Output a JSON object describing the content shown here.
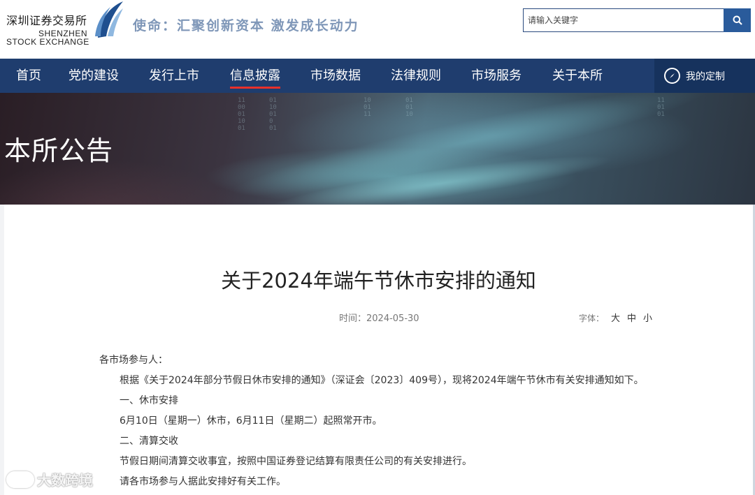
{
  "header": {
    "logo_cn": "深圳证券交易所",
    "logo_en_line1": "SHENZHEN",
    "logo_en_line2": "STOCK EXCHANGE",
    "slogan": "使命：汇聚创新资本 激发成长动力",
    "search_placeholder": "请输入关键字"
  },
  "nav": {
    "items": [
      {
        "label": "首页"
      },
      {
        "label": "党的建设"
      },
      {
        "label": "发行上市"
      },
      {
        "label": "信息披露"
      },
      {
        "label": "市场数据"
      },
      {
        "label": "法律规则"
      },
      {
        "label": "市场服务"
      },
      {
        "label": "关于本所"
      }
    ],
    "active_index": 3,
    "custom_label": "我的定制"
  },
  "banner": {
    "title": "本所公告"
  },
  "article": {
    "title": "关于2024年端午节休市安排的通知",
    "time_label": "时间：",
    "time_value": "2024-05-30",
    "font_label": "字体：",
    "font_sizes": [
      "大",
      "中",
      "小"
    ],
    "paragraphs": [
      "各市场参与人：",
      "根据《关于2024年部分节假日休市安排的通知》（深证会〔2023〕409号），现将2024年端午节休市有关安排通知如下。",
      "一、休市安排",
      "6月10日（星期一）休市，6月11日（星期二）起照常开市。",
      "二、清算交收",
      "节假日期间清算交收事宜，按照中国证券登记结算有限责任公司的有关安排进行。",
      "请各市场参与人据此安排好有关工作。"
    ]
  },
  "watermark": {
    "text": "大数跨境"
  },
  "colors": {
    "nav_bg": "#1f3d6e",
    "nav_active_underline": "#e8302a",
    "search_button": "#2a5b9b",
    "slogan": "#7f97b8"
  }
}
